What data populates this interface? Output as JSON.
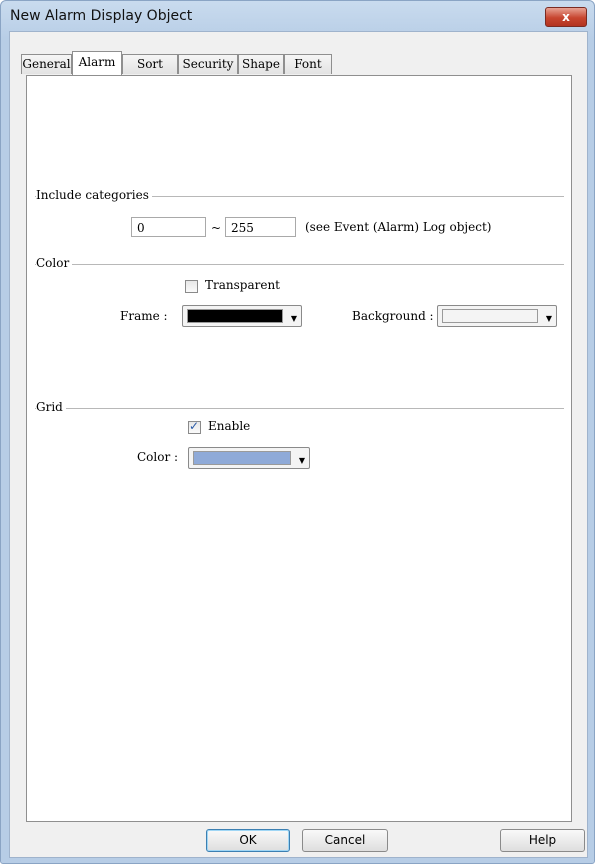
{
  "window": {
    "title": "New Alarm Display Object",
    "close_label": "x"
  },
  "tabs": [
    {
      "label": "General"
    },
    {
      "label": "Alarm"
    },
    {
      "label": "Sort"
    },
    {
      "label": "Security"
    },
    {
      "label": "Shape"
    },
    {
      "label": "Font"
    }
  ],
  "active_tab": "Alarm",
  "include_categories": {
    "title": "Include categories",
    "from_value": "0",
    "separator": "~",
    "to_value": "255",
    "hint": "(see Event (Alarm) Log object)"
  },
  "color": {
    "title": "Color",
    "transparent_label": "Transparent",
    "transparent_checked": false,
    "frame_label": "Frame :",
    "frame_color": "#000000",
    "background_label": "Background :",
    "background_color": "#f4f4f4"
  },
  "grid": {
    "title": "Grid",
    "enable_label": "Enable",
    "enable_checked": true,
    "color_label": "Color :",
    "color_value": "#8faad8"
  },
  "buttons": {
    "ok": "OK",
    "cancel": "Cancel",
    "help": "Help"
  }
}
